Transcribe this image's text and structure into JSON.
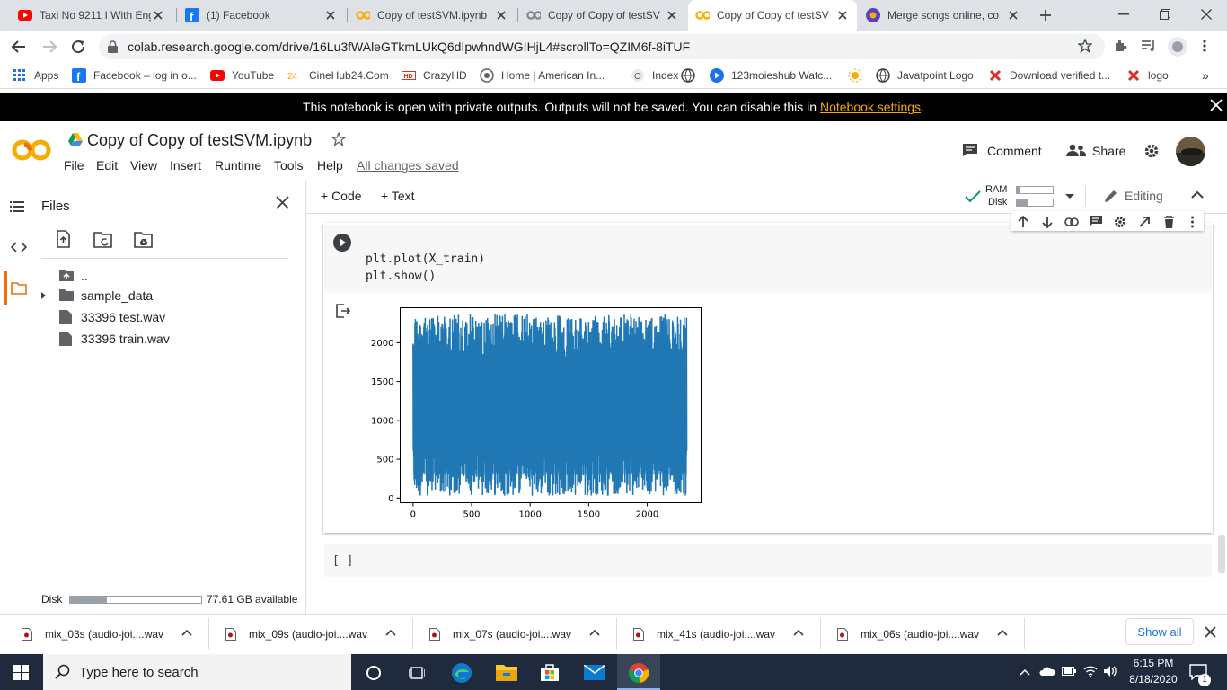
{
  "browser": {
    "tabs": [
      {
        "title": "Taxi No 9211 I With Eng",
        "favicon": "youtube-icon"
      },
      {
        "title": "(1) Facebook",
        "favicon": "facebook-icon"
      },
      {
        "title": "Copy of testSVM.ipynb",
        "favicon": "colab-icon"
      },
      {
        "title": "Copy of Copy of testSV",
        "favicon": "colab-icon"
      },
      {
        "title": "Copy of Copy of testSV",
        "favicon": "colab-icon"
      },
      {
        "title": "Merge songs online, co",
        "favicon": "merge-icon"
      }
    ],
    "url": "colab.research.google.com/drive/16Lu3fWAleGTkmLUkQ6dIpwhndWGIHjL4#scrollTo=QZIM6f-8iTUF",
    "bookmarks": [
      {
        "label": "Apps",
        "icon": "apps-grid-icon"
      },
      {
        "label": "Facebook – log in o...",
        "icon": "facebook-icon"
      },
      {
        "label": "YouTube",
        "icon": "youtube-icon"
      },
      {
        "label": "CineHub24.Com",
        "icon": "cinehub-icon"
      },
      {
        "label": "CrazyHD",
        "icon": "hd-icon"
      },
      {
        "label": "Home | American In...",
        "icon": "globe-icon"
      },
      {
        "label": "Index",
        "icon": "globe-icon"
      },
      {
        "label": "123moieshub Watc...",
        "icon": "play-circle-icon"
      },
      {
        "label": "Javatpoint Logo",
        "icon": "globe-icon"
      },
      {
        "label": "Download verified t...",
        "icon": "x-logo-icon"
      },
      {
        "label": "logo",
        "icon": "x-logo-icon"
      }
    ],
    "more_bookmarks": "»"
  },
  "banner": {
    "text": "This notebook is open with private outputs. Outputs will not be saved. You can disable this in",
    "link": "Notebook settings",
    "end": "."
  },
  "colab": {
    "logo": "CO",
    "title": "Copy of Copy of testSVM.ipynb",
    "menu": [
      "File",
      "Edit",
      "View",
      "Insert",
      "Runtime",
      "Tools",
      "Help"
    ],
    "save_status": "All changes saved",
    "comment": "Comment",
    "share": "Share",
    "add_code": "+ Code",
    "add_text": "+ Text",
    "ram_label": "RAM",
    "disk_label": "Disk",
    "editing": "Editing"
  },
  "files_panel": {
    "title": "Files",
    "items": [
      {
        "name": "..",
        "icon": "folder-up-icon"
      },
      {
        "name": "sample_data",
        "icon": "folder-icon"
      },
      {
        "name": "33396 test.wav",
        "icon": "file-icon"
      },
      {
        "name": "33396 train.wav",
        "icon": "file-icon"
      }
    ],
    "disk_label": "Disk",
    "disk_available": "77.61 GB available",
    "disk_fill_fraction": 0.28
  },
  "cell": {
    "code": [
      "plt.plot(X_train)",
      "plt.show()"
    ],
    "empty_cell": "[ ]"
  },
  "chart_data": {
    "type": "line",
    "title": "",
    "xlabel": "",
    "ylabel": "",
    "xlim": [
      -110,
      2460
    ],
    "ylim": [
      -60,
      2450
    ],
    "xticks": [
      0,
      500,
      1000,
      1500,
      2000
    ],
    "yticks": [
      0,
      500,
      1000,
      1500,
      2000
    ],
    "series": [
      {
        "color": "#1f77b4",
        "n_points": 2340,
        "min": 30,
        "max": 2370
      }
    ],
    "grid": false
  },
  "downloads": [
    "mix_03s (audio-joi....wav",
    "mix_09s (audio-joi....wav",
    "mix_07s (audio-joi....wav",
    "mix_41s (audio-joi....wav",
    "mix_06s (audio-joi....wav"
  ],
  "show_all": "Show all",
  "taskbar": {
    "search_placeholder": "Type here to search",
    "time": "6:15 PM",
    "date": "8/18/2020",
    "notification_count": "1"
  }
}
